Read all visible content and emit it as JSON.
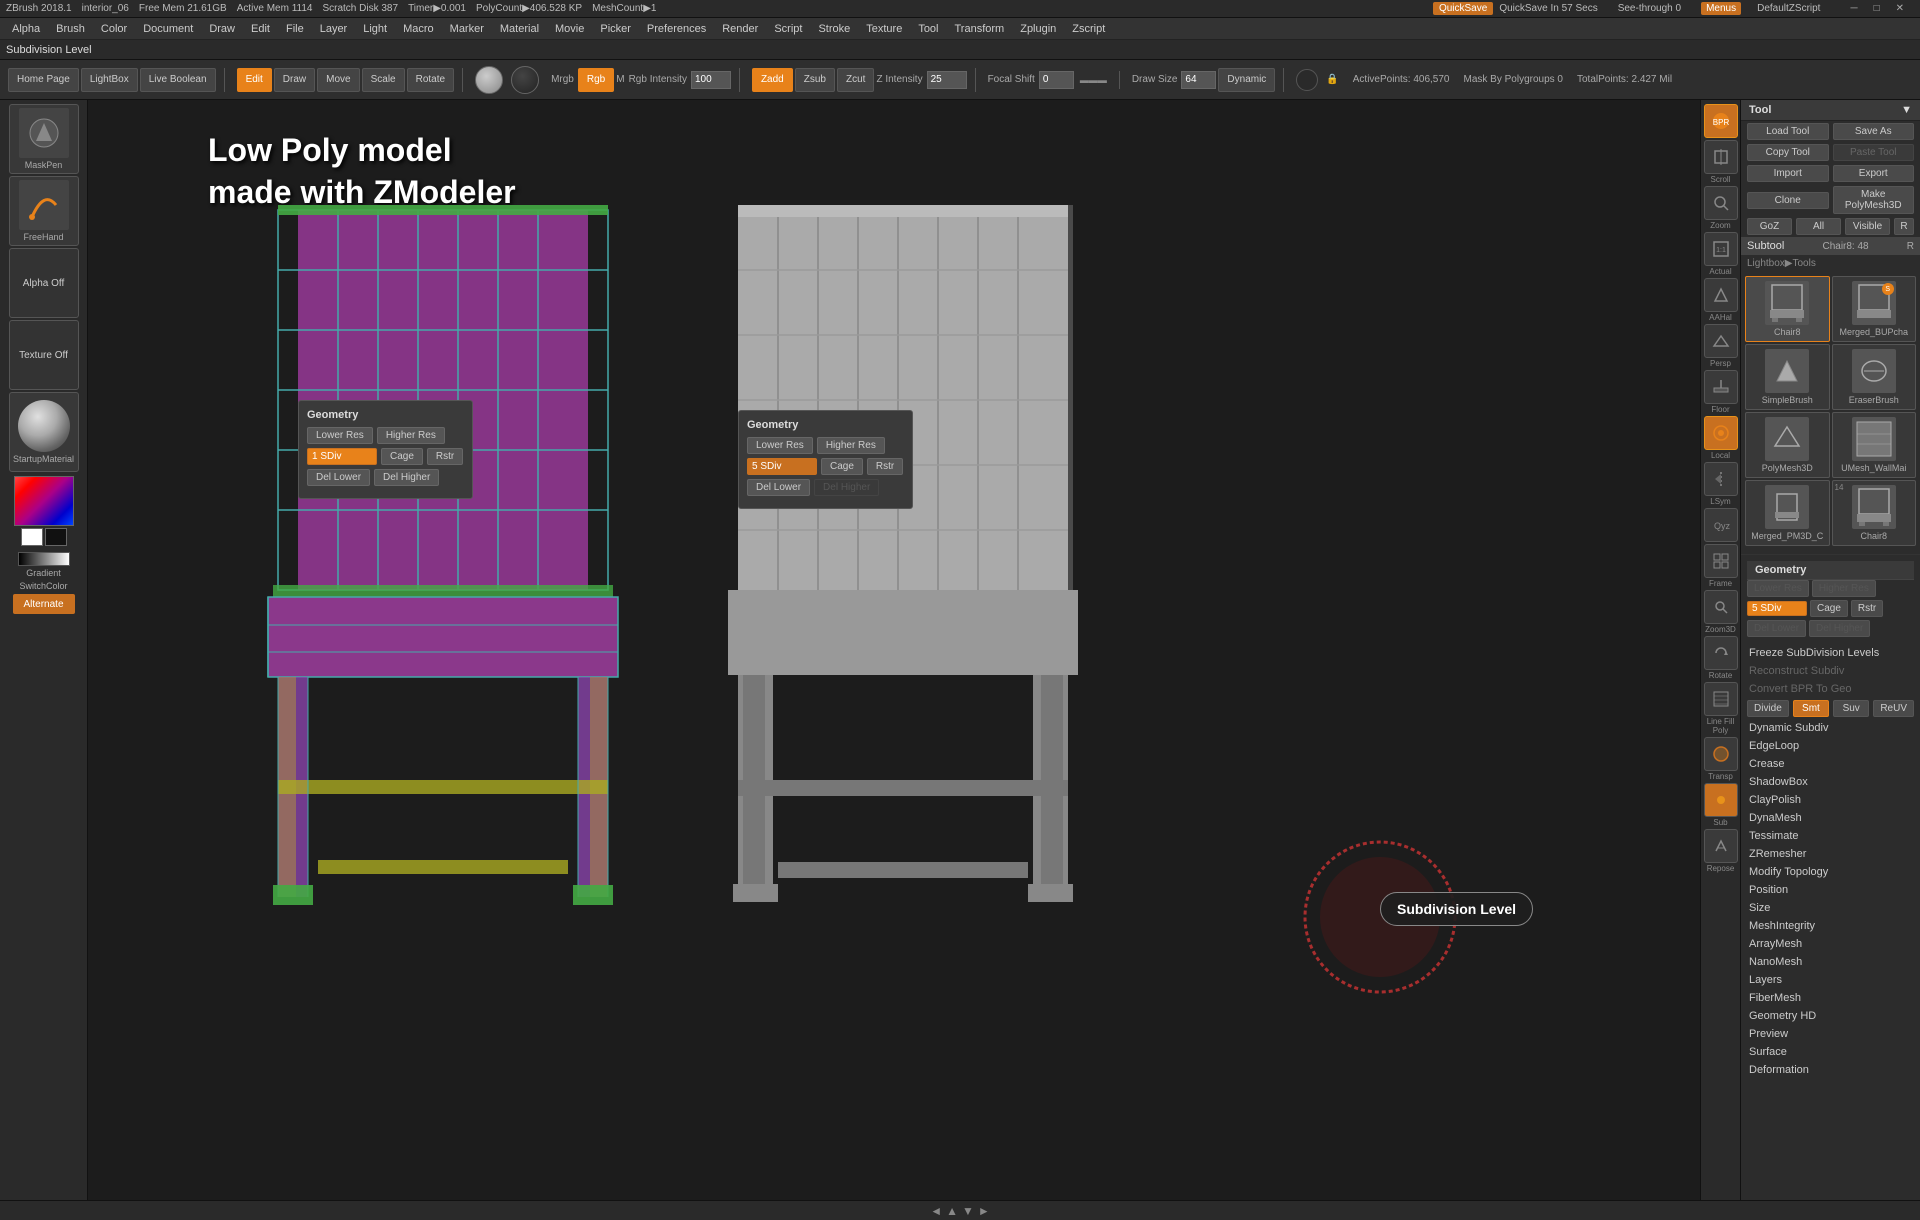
{
  "app": {
    "title": "ZBrush 2018.1",
    "file": "interior_06",
    "free_mem": "Free Mem 21.61GB",
    "active_mem": "Active Mem 1114",
    "scratch_disk": "Scratch Disk 387",
    "timer": "Timer▶0.001",
    "poly_count": "PolyCount▶406.528 KP",
    "mesh_count": "MeshCount▶1",
    "quick_save": "QuickSave In 57 Secs",
    "quick_save_btn": "QuickSave",
    "see_through": "See-through 0",
    "menus": "Menus",
    "default_z_script": "DefaultZScript"
  },
  "menubar": {
    "items": [
      "Alpha",
      "Brush",
      "Color",
      "Document",
      "Draw",
      "Edit",
      "File",
      "Layer",
      "Light",
      "Macro",
      "Marker",
      "Material",
      "Movie",
      "Picker",
      "Preferences",
      "Render",
      "Script",
      "Stroke",
      "Texture",
      "Tool",
      "Transform",
      "Zplugin",
      "Zscript"
    ]
  },
  "toolbar": {
    "home_page": "Home Page",
    "lightbox": "LightBox",
    "live_boolean": "Live Boolean",
    "edit": "Edit",
    "draw": "Draw",
    "move": "Move",
    "scale": "Scale",
    "rotate": "Rotate",
    "mrgb": "Mrgb",
    "rgb": "Rgb",
    "rgb_val": "M",
    "rgb_intensity": "Rgb Intensity",
    "rgb_intensity_val": "100",
    "zadd": "Zadd",
    "zsub": "Zsub",
    "zcut": "Zcut",
    "z_intensity": "Z Intensity",
    "z_intensity_val": "25",
    "focal_shift": "Focal Shift",
    "focal_val": "0",
    "draw_size": "Draw Size",
    "draw_val": "64",
    "dynamic": "Dynamic",
    "active_points": "ActivePoints: 406,570",
    "mask_by_polygroups": "Mask By Polygroups 0",
    "total_points": "TotalPoints: 2.427 Mil"
  },
  "left_panel": {
    "mask_pen": "MaskPen",
    "free_hand": "FreeHand",
    "alpha_off": "Alpha Off",
    "texture_off": "Texture Off",
    "startup_material": "StartupMaterial",
    "gradient": "Gradient",
    "switch_color": "SwitchColor",
    "alternate": "Alternate"
  },
  "canvas": {
    "label_line1": "Low Poly model",
    "label_line2": "made with ZModeler"
  },
  "geo_popup1": {
    "title": "Geometry",
    "lower_res": "Lower Res",
    "higher_res": "Higher Res",
    "sdiv": "1 SDiv",
    "cage": "Cage",
    "rstr": "Rstr",
    "del_lower": "Del Lower",
    "del_higher": "Del Higher"
  },
  "geo_popup2": {
    "title": "Geometry",
    "lower_res": "Lower Res",
    "higher_res": "Higher Res",
    "sdiv": "5 SDiv",
    "cage": "Cage",
    "rstr": "Rstr",
    "del_lower": "Del Lower",
    "del_higher": "Del Higher"
  },
  "subdivision_tooltip": "Subdivision Level",
  "right_icons": {
    "bpr": "BPR",
    "scroll": "Scroll",
    "zoom": "Zoom",
    "actual": "Actual",
    "aahal": "AAHal",
    "persp": "Persp",
    "floor": "Floor",
    "local": "Local",
    "qyz": "Qyz",
    "frame": "Frame",
    "zoom3d": "Zoom3D",
    "rotate": "Rotate",
    "line_fill": "Line Fill Poly",
    "transp": "Transp",
    "sub": "Sub",
    "lsym": "LSym",
    "repose": "Repose"
  },
  "tool_panel": {
    "title": "Tool",
    "load_tool": "Load Tool",
    "save_as": "Save As",
    "copy_tool": "Copy Tool",
    "paste_tool": "Paste Tool",
    "import": "Import",
    "export": "Export",
    "clone": "Clone",
    "make_polymesh3d": "Make PolyMesh3D",
    "goz": "GoZ",
    "all": "All",
    "visible": "Visible",
    "r": "R",
    "subtool_label": "Subtool",
    "chair8_48": "Chair8: 48",
    "r2": "R",
    "lightbox_tools": "Lightbox▶Tools",
    "brushes": [
      {
        "name": "Chair8",
        "badge": ""
      },
      {
        "name": "Merged_BUPcha",
        "badge": ""
      },
      {
        "name": "SimpleBrush",
        "badge": ""
      },
      {
        "name": "EraserBrush",
        "badge": ""
      },
      {
        "name": "PolyMesh3D",
        "badge": ""
      },
      {
        "name": "UMesh_WallMai",
        "badge": ""
      },
      {
        "name": "Merged_PM3D_C",
        "badge": ""
      },
      {
        "name": "Chair8",
        "badge": "14"
      }
    ],
    "geometry_section": {
      "title": "Geometry",
      "lower_res": "Lower Res",
      "higher_res": "Higher Res",
      "sdiv_val": "5 SDiv",
      "cage": "Cage",
      "rstr": "Rstr",
      "del_lower": "Del Lower",
      "del_higher": "Del Higher",
      "freeze_subdiv": "Freeze SubDivision Levels",
      "reconstruct_subdiv": "Reconstruct Subdiv",
      "convert_bpr": "Convert BPR To Geo",
      "divide": "Divide",
      "smt": "Smt",
      "suv": "Suv",
      "reuv": "ReUV",
      "dynamic_subdiv": "Dynamic Subdiv",
      "edge_loop": "EdgeLoop",
      "crease": "Crease",
      "shadow_box": "ShadowBox",
      "clay_polish": "ClayPolish",
      "dyna_mesh": "DynaMesh",
      "tessimate": "Tessimate",
      "zremesher": "ZRemesher",
      "modify_topology": "Modify Topology",
      "position": "Position",
      "size": "Size",
      "mesh_integrity": "MeshIntegrity",
      "array_mesh": "ArrayMesh",
      "nano_mesh": "NanoMesh",
      "layers": "Layers",
      "fiber_mesh": "FiberMesh",
      "geometry_hd": "Geometry HD",
      "preview": "Preview",
      "surface": "Surface",
      "deformation": "Deformation"
    }
  },
  "layers_bar": {
    "label": "Layers"
  }
}
